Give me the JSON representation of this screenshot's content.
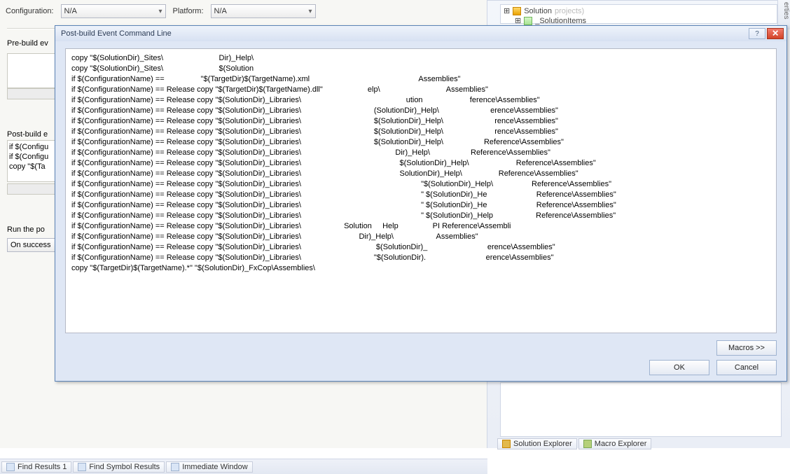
{
  "config_bar": {
    "config_label": "Configuration:",
    "config_value": "N/A",
    "platform_label": "Platform:",
    "platform_value": "N/A"
  },
  "sections": {
    "prebuild_label": "Pre-build ev",
    "postbuild_label": "Post-build e",
    "run_label": "Run the po",
    "run_value": "On success",
    "postbuild_snippet1": "if $(Configu",
    "postbuild_snippet2": "if $(Configu",
    "postbuild_snippet3": "copy \"$(Ta"
  },
  "solution_explorer": {
    "solution_text": "Solution",
    "solution_suffix": "projects)",
    "folder_text": "_SolutionItems",
    "tab1": "Solution Explorer",
    "tab2": "Macro Explorer",
    "vertical": "erties"
  },
  "bottom_tabs": {
    "t1": "Find Results 1",
    "t2": "Find Symbol Results",
    "t3": "Immediate Window"
  },
  "dialog": {
    "title": "Post-build Event Command Line",
    "macros_btn": "Macros >>",
    "ok_btn": "OK",
    "cancel_btn": "Cancel",
    "lines": [
      "copy \"$(SolutionDir)_Sites\\                          Dir)_Help\\",
      "copy \"$(SolutionDir)_Sites\\                          $(Solution",
      "if $(ConfigurationName) ==                 \"$(TargetDir)$(TargetName).xml                                                   Assemblies\"",
      "if $(ConfigurationName) == Release copy \"$(TargetDir)$(TargetName).dll\"                     elp\\                               Assemblies\"",
      "if $(ConfigurationName) == Release copy \"$(SolutionDir)_Libraries\\                                                 ution                      ference\\Assemblies\"",
      "if $(ConfigurationName) == Release copy \"$(SolutionDir)_Libraries\\                                  (SolutionDir)_Help\\                        erence\\Assemblies\"",
      "if $(ConfigurationName) == Release copy \"$(SolutionDir)_Libraries\\                                  $(SolutionDir)_Help\\                        rence\\Assemblies\"",
      "if $(ConfigurationName) == Release copy \"$(SolutionDir)_Libraries\\                                  $(SolutionDir)_Help\\                        rence\\Assemblies\"",
      "if $(ConfigurationName) == Release copy \"$(SolutionDir)_Libraries\\                                  $(SolutionDir)_Help\\                   Reference\\Assemblies\"",
      "if $(ConfigurationName) == Release copy \"$(SolutionDir)_Libraries\\                                            Dir)_Help\\                   Reference\\Assemblies\"",
      "if $(ConfigurationName) == Release copy \"$(SolutionDir)_Libraries\\                                              $(SolutionDir)_Help\\                      Reference\\Assemblies\"",
      "if $(ConfigurationName) == Release copy \"$(SolutionDir)_Libraries\\                                              SolutionDir)_Help\\                 Reference\\Assemblies\"",
      "if $(ConfigurationName) == Release copy \"$(SolutionDir)_Libraries\\                                                        \"$(SolutionDir)_Help\\                  Reference\\Assemblies\"",
      "if $(ConfigurationName) == Release copy \"$(SolutionDir)_Libraries\\                                                        \" $(SolutionDir)_He                       Reference\\Assemblies\"",
      "if $(ConfigurationName) == Release copy \"$(SolutionDir)_Libraries\\                                                        \" $(SolutionDir)_He                       Reference\\Assemblies\"",
      "if $(ConfigurationName) == Release copy \"$(SolutionDir)_Libraries\\                                                        \" $(SolutionDir)_Help                    Reference\\Assemblies\"",
      "if $(ConfigurationName) == Release copy \"$(SolutionDir)_Libraries\\                    Solution     Help                PI Reference\\Assembli",
      "if $(ConfigurationName) == Release copy \"$(SolutionDir)_Libraries\\                           Dir)_Help\\                    Assemblies\"",
      "if $(ConfigurationName) == Release copy \"$(SolutionDir)_Libraries\\                                   $(SolutionDir)_                            erence\\Assemblies\"",
      "if $(ConfigurationName) == Release copy \"$(SolutionDir)_Libraries\\                                  \"$(SolutionDir).                            erence\\Assemblies\"",
      "copy \"$(TargetDir)$(TargetName).*\" \"$(SolutionDir)_FxCop\\Assemblies\\"
    ]
  }
}
